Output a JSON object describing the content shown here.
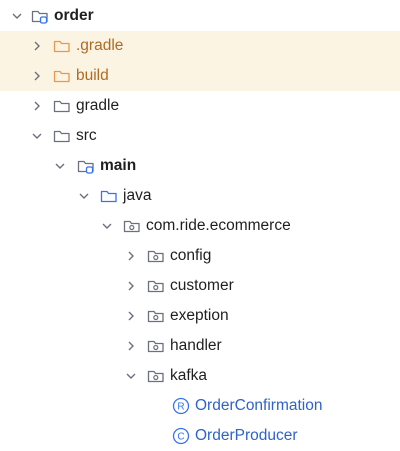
{
  "tree": {
    "items": [
      {
        "label": "order",
        "icon": "module-folder-icon",
        "chevron": "down",
        "bold": true
      },
      {
        "label": ".gradle",
        "icon": "excluded-folder-icon",
        "chevron": "right",
        "excluded": true
      },
      {
        "label": "build",
        "icon": "excluded-folder-icon",
        "chevron": "right",
        "excluded": true
      },
      {
        "label": "gradle",
        "icon": "folder-icon",
        "chevron": "right"
      },
      {
        "label": "src",
        "icon": "folder-icon",
        "chevron": "down"
      },
      {
        "label": "main",
        "icon": "module-folder-icon",
        "chevron": "down",
        "bold": true
      },
      {
        "label": "java",
        "icon": "source-folder-icon",
        "chevron": "down"
      },
      {
        "label": "com.ride.ecommerce",
        "icon": "package-icon",
        "chevron": "down"
      },
      {
        "label": "config",
        "icon": "package-icon",
        "chevron": "right"
      },
      {
        "label": "customer",
        "icon": "package-icon",
        "chevron": "right"
      },
      {
        "label": "exeption",
        "icon": "package-icon",
        "chevron": "right"
      },
      {
        "label": "handler",
        "icon": "package-icon",
        "chevron": "right"
      },
      {
        "label": "kafka",
        "icon": "package-icon",
        "chevron": "down"
      },
      {
        "label": "OrderConfirmation",
        "icon": "record-icon",
        "badge": "R"
      },
      {
        "label": "OrderProducer",
        "icon": "class-icon",
        "badge": "C"
      }
    ]
  },
  "colors": {
    "excluded_row_bg": "#fcf4e3",
    "excluded_folder": "#e8984c",
    "excluded_text": "#ad6b24",
    "folder_stroke": "#6c707e",
    "source_folder": "#3574f0",
    "class_text": "#2f63c7"
  }
}
